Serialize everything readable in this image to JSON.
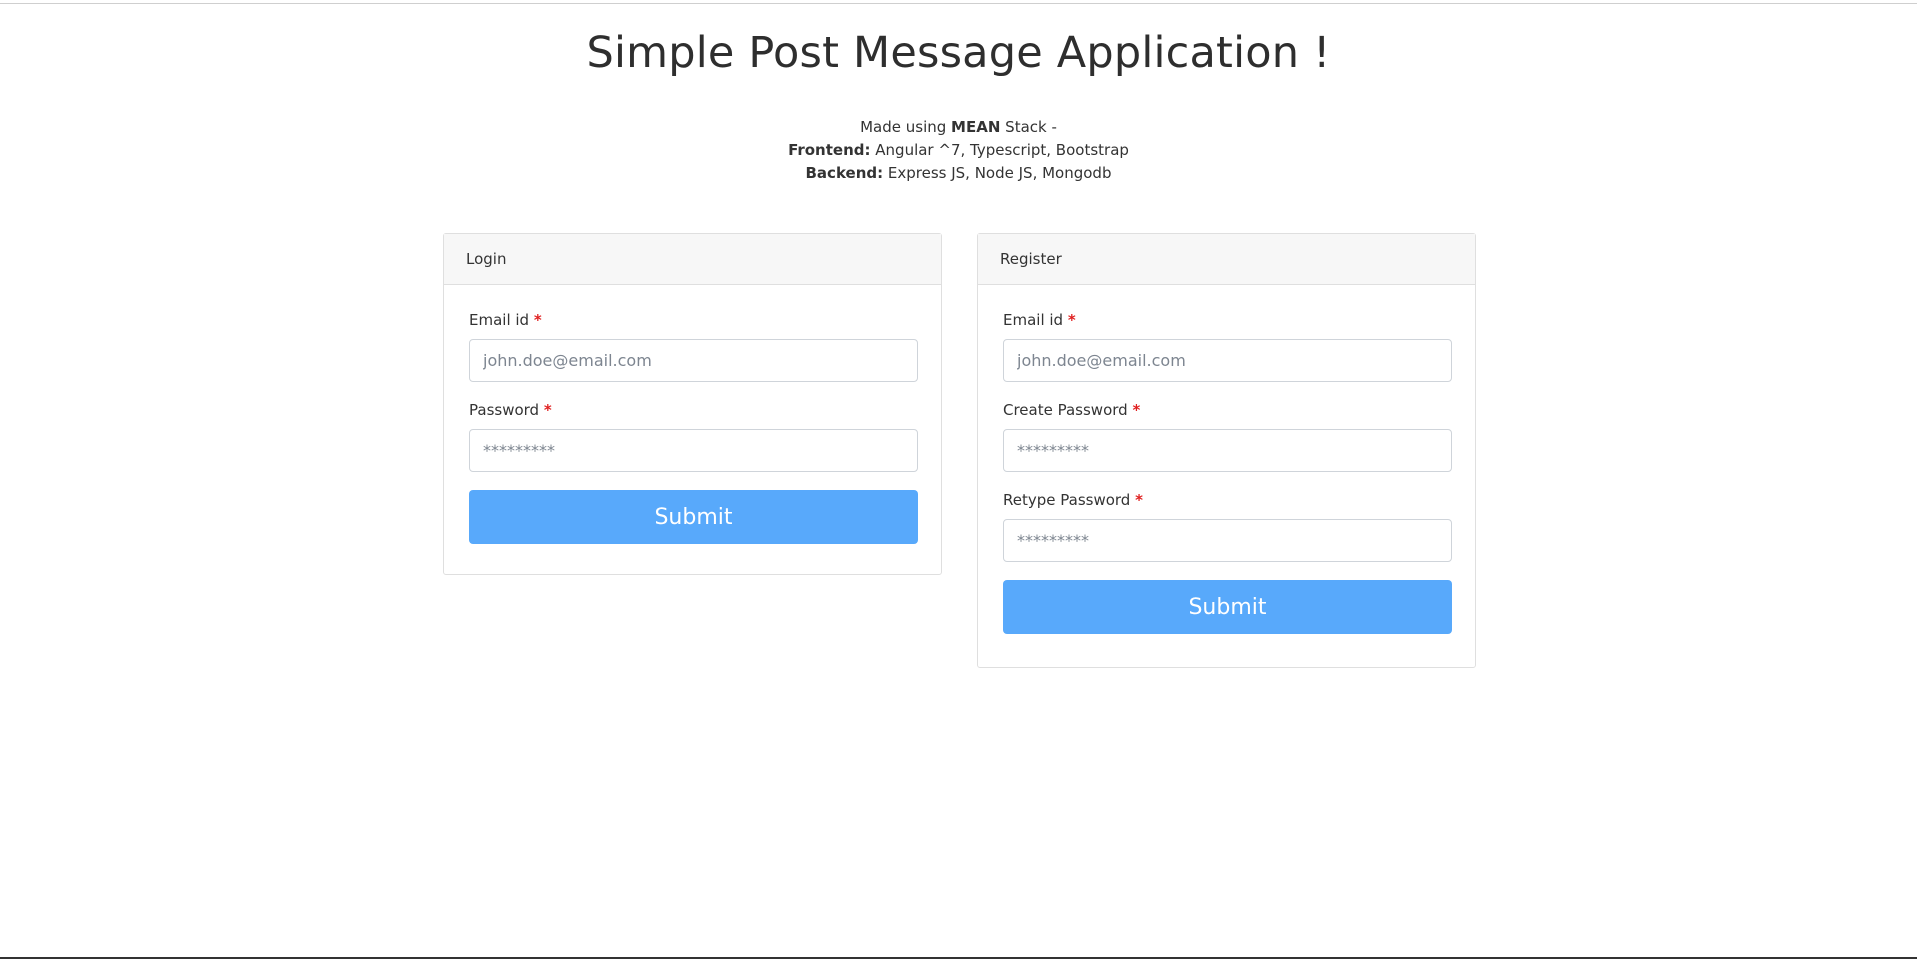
{
  "page": {
    "title": "Simple Post Message Application !"
  },
  "info": {
    "line1_prefix": "Made using",
    "line1_bold": "MEAN",
    "line1_suffix": "Stack -",
    "frontend_label": "Frontend:",
    "frontend_value": "Angular ^7, Typescript, Bootstrap",
    "backend_label": "Backend:",
    "backend_value": "Express JS, Node JS, Mongodb"
  },
  "login": {
    "header": "Login",
    "email_label": "Email id",
    "email_placeholder": "john.doe@email.com",
    "email_value": "",
    "password_label": "Password",
    "password_placeholder": "*********",
    "password_value": "",
    "required_marker": "*",
    "submit_label": "Submit"
  },
  "register": {
    "header": "Register",
    "email_label": "Email id",
    "email_placeholder": "john.doe@email.com",
    "email_value": "",
    "create_password_label": "Create Password",
    "create_password_placeholder": "*********",
    "create_password_value": "",
    "retype_password_label": "Retype Password",
    "retype_password_placeholder": "*********",
    "retype_password_value": "",
    "required_marker": "*",
    "submit_label": "Submit"
  },
  "colors": {
    "primary_button": "#58a9fb",
    "required_marker": "#e02020",
    "card_header_bg": "#f7f7f7",
    "text": "#333333"
  }
}
